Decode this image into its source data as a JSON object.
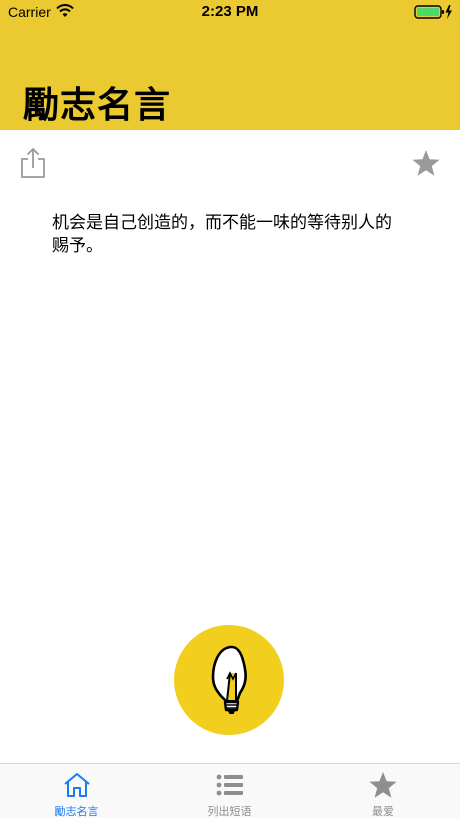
{
  "status_bar": {
    "carrier": "Carrier",
    "time": "2:23 PM"
  },
  "header": {
    "title": "勵志名言",
    "background_color": "#EBC931"
  },
  "actions": {
    "share_icon": "share-icon",
    "favorite_icon": "star-icon"
  },
  "quote": {
    "text": "机会是自己创造的，而不能一味的等待别人的赐予。"
  },
  "fab": {
    "icon": "lightbulb-icon",
    "color": "#F2CE1F"
  },
  "tab_bar": {
    "active_color": "#1A7CF5",
    "inactive_color": "#8e8e8e",
    "tabs": [
      {
        "label": "勵志名言",
        "icon": "home-icon",
        "active": true
      },
      {
        "label": "列出短语",
        "icon": "list-icon",
        "active": false
      },
      {
        "label": "最爱",
        "icon": "star-icon",
        "active": false
      }
    ]
  }
}
